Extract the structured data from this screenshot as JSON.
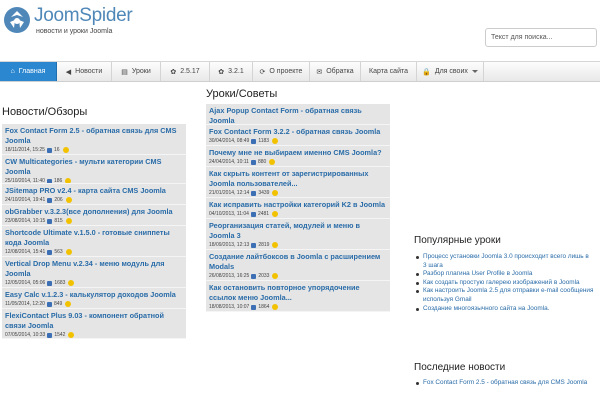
{
  "site": {
    "name": "JoomSpider",
    "tagline": "новости и уроки Joomla"
  },
  "search": {
    "placeholder": "Текст для поиска..."
  },
  "nav": [
    {
      "label": "Главная",
      "icon": "home-icon",
      "glyph": "⌂",
      "active": true
    },
    {
      "label": "Новости",
      "icon": "megaphone-icon",
      "glyph": "◀"
    },
    {
      "label": "Уроки",
      "icon": "book-icon",
      "glyph": "▤"
    },
    {
      "label": "2.5.17",
      "icon": "joomla-icon",
      "glyph": "✿"
    },
    {
      "label": "3.2.1",
      "icon": "joomla-icon",
      "glyph": "✿"
    },
    {
      "label": "О проекте",
      "icon": "info-icon",
      "glyph": "⟳"
    },
    {
      "label": "Обратка",
      "icon": "mail-icon",
      "glyph": "✉"
    },
    {
      "label": "Карта сайта",
      "icon": "",
      "glyph": ""
    },
    {
      "label": "Для своих",
      "icon": "lock-icon",
      "glyph": "🔒",
      "dropdown": true
    }
  ],
  "news": {
    "title": "Новости/Обзоры",
    "items": [
      {
        "title": "Fox Contact Form 2.5 - обратная связь для CMS Joomla",
        "date": "18/11/2014, 15:25",
        "views": "16"
      },
      {
        "title": "CW Multicategories - мульти категории CMS Joomla",
        "date": "25/10/2014, 11:40",
        "views": "186"
      },
      {
        "title": "JSitemap PRO v2.4 - карта сайта CMS Joomla",
        "date": "24/10/2014, 19:41",
        "views": "206"
      },
      {
        "title": "obGrabber v.3.2.3(все дополнения) для Joomla",
        "date": "23/08/2014, 10:15",
        "views": "815"
      },
      {
        "title": "Shortcode Ultimate v.1.5.0 - готовые сниппеты кода Joomla",
        "date": "12/08/2014, 15:41",
        "views": "563"
      },
      {
        "title": "Vertical Drop Menu v.2.34 - меню модуль для Joomla",
        "date": "12/05/2014, 05:06",
        "views": "1683"
      },
      {
        "title": "Easy Calc v.1.2.3 - калькулятор доходов Joomla",
        "date": "11/05/2014, 12:20",
        "views": "849"
      },
      {
        "title": "FlexiContact Plus 9.03 - компонент обратной связи Joomla",
        "date": "07/05/2014, 10:33",
        "views": "1542"
      }
    ]
  },
  "lessons": {
    "title": "Уроки/Советы",
    "items": [
      {
        "title": "Ajax Popup Contact Form - обратная связь Joomla",
        "date": "02/06/2014, 18:46",
        "views": "684"
      },
      {
        "title": "Fox Contact Form 3.2.2 - обратная связь Joomla",
        "date": "30/04/2014, 08:49",
        "views": "1183"
      },
      {
        "title": "Почему мне не выбираем именно CMS Joomla?",
        "date": "24/04/2014, 10:11",
        "views": "880"
      },
      {
        "title": "Как скрыть контент от зарегистрированных Joomla пользователей...",
        "date": "21/01/2014, 12:14",
        "views": "3439"
      },
      {
        "title": "Как исправить настройки категорий K2 в Joomla",
        "date": "04/10/2013, 11:04",
        "views": "2481"
      },
      {
        "title": "Реорганизация статей, модулей и меню в Joomla 3",
        "date": "18/09/2013, 12:13",
        "views": "2819"
      },
      {
        "title": "Создание лайтбоксов в Joomla с расширением Modals",
        "date": "26/08/2013, 16:25",
        "views": "2033"
      },
      {
        "title": "Как остановить повторное упорядочение ссылок меню Joomla...",
        "date": "18/08/2013, 10:07",
        "views": "1864"
      }
    ]
  },
  "popular": {
    "title": "Популярные уроки",
    "items": [
      "Процесс установки Joomla 3.0 происходит всего лишь в 3 шага",
      "Разбор плагина User Profile в Joomla",
      "Как создать простую галерею изображений в Joomla",
      "Как настроить Joomla 2.5 для отправки e-mail сообщения используя Gmail",
      "Создание многоязычного сайта на Joomla."
    ]
  },
  "latest": {
    "title": "Последние новости",
    "items": [
      "Fox Contact Form 2.5 - обратная связь для CMS Joomla"
    ]
  }
}
